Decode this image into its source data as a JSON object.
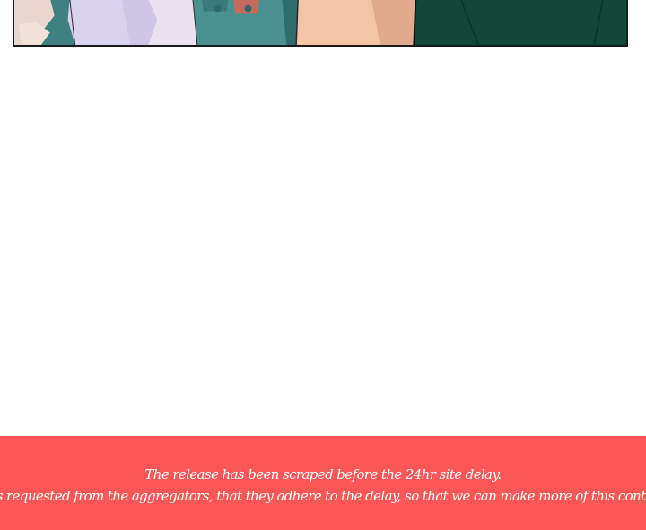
{
  "comic_panel": {
    "description_icon": "comic-panel-image"
  },
  "notice": {
    "line1": "The release has been scraped before the 24hr site delay.",
    "line2": "it is requested from the aggregators, that they adhere to the delay, so that we can make more of this content",
    "background_color": "#fd5656",
    "text_color": "#ffffff"
  }
}
